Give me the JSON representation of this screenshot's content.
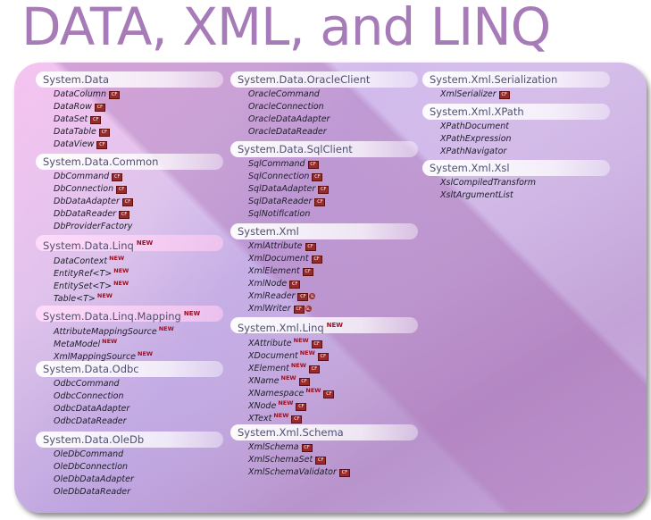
{
  "title": "DATA, XML, and LINQ",
  "badges": {
    "new": "NEW",
    "cf": "CF",
    "sl": "SL"
  },
  "colors": {
    "title": "#a77bb8",
    "new_badge": "#9b1020",
    "cf_badge": "#9a2a2a"
  },
  "columns": [
    [
      {
        "name": "System.Data",
        "items": [
          {
            "t": "DataColumn",
            "cf": true
          },
          {
            "t": "DataRow",
            "cf": true
          },
          {
            "t": "DataSet",
            "cf": true
          },
          {
            "t": "DataTable",
            "cf": true
          },
          {
            "t": "DataView",
            "cf": true
          }
        ]
      },
      {
        "name": "System.Data.Common",
        "items": [
          {
            "t": "DbCommand",
            "cf": true
          },
          {
            "t": "DbConnection",
            "cf": true
          },
          {
            "t": "DbDataAdapter",
            "cf": true
          },
          {
            "t": "DbDataReader",
            "cf": true
          },
          {
            "t": "DbProviderFactory"
          }
        ]
      },
      {
        "name": "System.Data.Linq",
        "new": true,
        "highlight": true,
        "items": [
          {
            "t": "DataContext",
            "new": true
          },
          {
            "t": "EntityRef<T>",
            "new": true
          },
          {
            "t": "EntitySet<T>",
            "new": true
          },
          {
            "t": "Table<T>",
            "new": true
          }
        ]
      },
      {
        "name": "System.Data.Linq.Mapping",
        "new": true,
        "highlight": true,
        "items": [
          {
            "t": "AttributeMappingSource",
            "new": true
          },
          {
            "t": "MetaModel",
            "new": true
          },
          {
            "t": "XmlMappingSource",
            "new": true
          }
        ]
      },
      {
        "name": "System.Data.Odbc",
        "items": [
          {
            "t": "OdbcCommand"
          },
          {
            "t": "OdbcConnection"
          },
          {
            "t": "OdbcDataAdapter"
          },
          {
            "t": "OdbcDataReader"
          }
        ]
      },
      {
        "name": "System.Data.OleDb",
        "items": [
          {
            "t": "OleDbCommand"
          },
          {
            "t": "OleDbConnection"
          },
          {
            "t": "OleDbDataAdapter"
          },
          {
            "t": "OleDbDataReader"
          }
        ]
      }
    ],
    [
      {
        "name": "System.Data.OracleClient",
        "items": [
          {
            "t": "OracleCommand"
          },
          {
            "t": "OracleConnection"
          },
          {
            "t": "OracleDataAdapter"
          },
          {
            "t": "OracleDataReader"
          }
        ]
      },
      {
        "name": "System.Data.SqlClient",
        "items": [
          {
            "t": "SqlCommand",
            "cf": true
          },
          {
            "t": "SqlConnection",
            "cf": true
          },
          {
            "t": "SqlDataAdapter",
            "cf": true
          },
          {
            "t": "SqlDataReader",
            "cf": true
          },
          {
            "t": "SqlNotification"
          }
        ]
      },
      {
        "name": "System.Xml",
        "items": [
          {
            "t": "XmlAttribute",
            "cf": true
          },
          {
            "t": "XmlDocument",
            "cf": true
          },
          {
            "t": "XmlElement",
            "cf": true
          },
          {
            "t": "XmlNode",
            "cf": true
          },
          {
            "t": "XmlReader",
            "cf": true,
            "sl": true
          },
          {
            "t": "XmlWriter",
            "cf": true,
            "sl": true
          }
        ]
      },
      {
        "name": "System.Xml.Linq",
        "new": true,
        "items": [
          {
            "t": "XAttribute",
            "new": true,
            "cf": true
          },
          {
            "t": "XDocument",
            "new": true,
            "cf": true
          },
          {
            "t": "XElement",
            "new": true,
            "cf": true
          },
          {
            "t": "XName",
            "new": true,
            "cf": true
          },
          {
            "t": "XNamespace",
            "new": true,
            "cf": true
          },
          {
            "t": "XNode",
            "new": true,
            "cf": true
          },
          {
            "t": "XText",
            "new": true,
            "cf": true
          }
        ]
      },
      {
        "name": "System.Xml.Schema",
        "items": [
          {
            "t": "XmlSchema",
            "cf": true
          },
          {
            "t": "XmlSchemaSet",
            "cf": true
          },
          {
            "t": "XmlSchemaValidator",
            "cf": true
          }
        ]
      }
    ],
    [
      {
        "name": "System.Xml.Serialization",
        "items": [
          {
            "t": "XmlSerializer",
            "cf": true
          }
        ]
      },
      {
        "name": "System.Xml.XPath",
        "items": [
          {
            "t": "XPathDocument"
          },
          {
            "t": "XPathExpression"
          },
          {
            "t": "XPathNavigator"
          }
        ]
      },
      {
        "name": "System.Xml.Xsl",
        "items": [
          {
            "t": "XslCompiledTransform"
          },
          {
            "t": "XsltArgumentList"
          }
        ]
      }
    ]
  ]
}
